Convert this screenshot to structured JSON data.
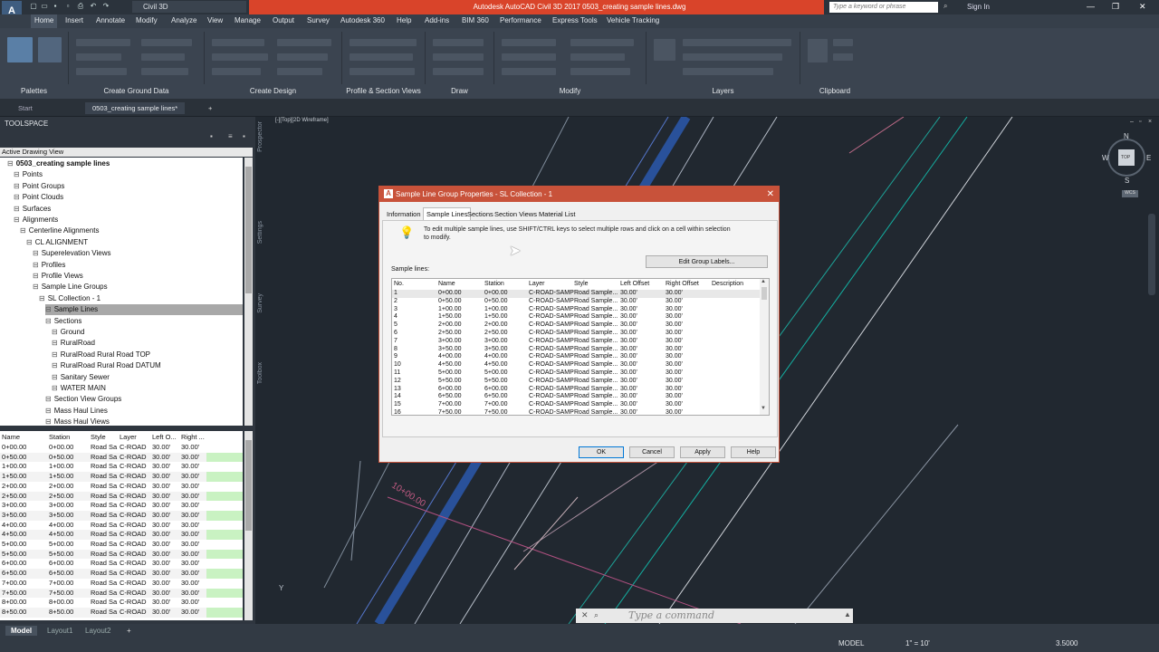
{
  "title_bar": {
    "app_title": "Autodesk AutoCAD Civil 3D 2017   0503_creating sample lines.dwg",
    "workspace": "Civil 3D",
    "search_placeholder": "Type a keyword or phrase",
    "sign_in": "Sign In"
  },
  "menu_tabs": [
    "Home",
    "Insert",
    "Annotate",
    "Modify",
    "Analyze",
    "View",
    "Manage",
    "Output",
    "Survey",
    "Autodesk 360",
    "Help",
    "Add-ins",
    "BIM 360",
    "Performance",
    "Express Tools",
    "Vehicle Tracking"
  ],
  "ribbon_panels": [
    "Palettes",
    "Create Ground Data",
    "Create Design",
    "Profile & Section Views",
    "Draw",
    "Modify",
    "Layers",
    "Clipboard"
  ],
  "doc_tabs": [
    "Start",
    "0503_creating sample lines*"
  ],
  "toolspace": {
    "title": "TOOLSPACE",
    "view_label": "Active Drawing View",
    "tree": [
      {
        "label": "0503_creating sample lines",
        "level": 0,
        "bold": true
      },
      {
        "label": "Points",
        "level": 1
      },
      {
        "label": "Point Groups",
        "level": 1
      },
      {
        "label": "Point Clouds",
        "level": 1
      },
      {
        "label": "Surfaces",
        "level": 1
      },
      {
        "label": "Alignments",
        "level": 1
      },
      {
        "label": "Centerline Alignments",
        "level": 2
      },
      {
        "label": "CL ALIGNMENT",
        "level": 3
      },
      {
        "label": "Superelevation Views",
        "level": 4
      },
      {
        "label": "Profiles",
        "level": 4
      },
      {
        "label": "Profile Views",
        "level": 4
      },
      {
        "label": "Sample Line Groups",
        "level": 4
      },
      {
        "label": "SL Collection - 1",
        "level": 5
      },
      {
        "label": "Sample Lines",
        "level": 6,
        "selected": true
      },
      {
        "label": "Sections",
        "level": 6
      },
      {
        "label": "Ground",
        "level": 7
      },
      {
        "label": "RuralRoad",
        "level": 7
      },
      {
        "label": "RuralRoad Rural Road TOP",
        "level": 7
      },
      {
        "label": "RuralRoad Rural Road DATUM",
        "level": 7
      },
      {
        "label": "Sanitary Sewer",
        "level": 7
      },
      {
        "label": "WATER MAIN",
        "level": 7
      },
      {
        "label": "Section View Groups",
        "level": 6
      },
      {
        "label": "Mass Haul Lines",
        "level": 6
      },
      {
        "label": "Mass Haul Views",
        "level": 6
      }
    ],
    "list_headers": [
      "Name",
      "Station",
      "Style",
      "Layer",
      "Left O...",
      "Right ..."
    ],
    "list_rows": [
      [
        "0+00.00",
        "0+00.00"
      ],
      [
        "0+50.00",
        "0+50.00"
      ],
      [
        "1+00.00",
        "1+00.00"
      ],
      [
        "1+50.00",
        "1+50.00"
      ],
      [
        "2+00.00",
        "2+00.00"
      ],
      [
        "2+50.00",
        "2+50.00"
      ],
      [
        "3+00.00",
        "3+00.00"
      ],
      [
        "3+50.00",
        "3+50.00"
      ],
      [
        "4+00.00",
        "4+00.00"
      ],
      [
        "4+50.00",
        "4+50.00"
      ],
      [
        "5+00.00",
        "5+00.00"
      ],
      [
        "5+50.00",
        "5+50.00"
      ],
      [
        "6+00.00",
        "6+00.00"
      ],
      [
        "6+50.00",
        "6+50.00"
      ],
      [
        "7+00.00",
        "7+00.00"
      ],
      [
        "7+50.00",
        "7+50.00"
      ],
      [
        "8+00.00",
        "8+00.00"
      ],
      [
        "8+50.00",
        "8+50.00"
      ]
    ],
    "list_style": "Road Sa",
    "list_layer": "C-ROAD",
    "list_offset": "30.00'",
    "side_tabs": [
      "Prospector",
      "Settings",
      "Survey",
      "Toolbox"
    ]
  },
  "viewport_label": "[-][Top][2D Wireframe]",
  "compass": {
    "n": "N",
    "s": "S",
    "e": "E",
    "w": "W",
    "top": "TOP",
    "wcs": "WCS"
  },
  "drawing_station_label": "10+00.00",
  "dialog": {
    "title": "Sample Line Group Properties - SL Collection - 1",
    "tabs": [
      "Information",
      "Sample Lines",
      "Sections",
      "Section Views",
      "Material List"
    ],
    "hint": "To edit multiple sample lines, use SHIFT/CTRL keys to select multiple rows and click on a cell within selection to modify.",
    "edit_labels_button": "Edit Group Labels...",
    "table_title": "Sample lines:",
    "headers": [
      "No.",
      "Name",
      "Station",
      "Layer",
      "Style",
      "Left Offset",
      "Right Offset",
      "Description"
    ],
    "rows": [
      [
        "1",
        "0+00.00",
        "0+00.00"
      ],
      [
        "2",
        "0+50.00",
        "0+50.00"
      ],
      [
        "3",
        "1+00.00",
        "1+00.00"
      ],
      [
        "4",
        "1+50.00",
        "1+50.00"
      ],
      [
        "5",
        "2+00.00",
        "2+00.00"
      ],
      [
        "6",
        "2+50.00",
        "2+50.00"
      ],
      [
        "7",
        "3+00.00",
        "3+00.00"
      ],
      [
        "8",
        "3+50.00",
        "3+50.00"
      ],
      [
        "9",
        "4+00.00",
        "4+00.00"
      ],
      [
        "10",
        "4+50.00",
        "4+50.00"
      ],
      [
        "11",
        "5+00.00",
        "5+00.00"
      ],
      [
        "12",
        "5+50.00",
        "5+50.00"
      ],
      [
        "13",
        "6+00.00",
        "6+00.00"
      ],
      [
        "14",
        "6+50.00",
        "6+50.00"
      ],
      [
        "15",
        "7+00.00",
        "7+00.00"
      ],
      [
        "16",
        "7+50.00",
        "7+50.00"
      ]
    ],
    "row_layer": "C-ROAD-SAMP",
    "row_style": "Road Sample...",
    "row_offset": "30.00'",
    "buttons": {
      "ok": "OK",
      "cancel": "Cancel",
      "apply": "Apply",
      "help": "Help"
    }
  },
  "command_line": {
    "placeholder": "Type a command"
  },
  "layout_tabs": [
    "Model",
    "Layout1",
    "Layout2"
  ],
  "status_bar": {
    "mode": "MODEL",
    "scale": "1\" = 10'",
    "precision": "3.5000"
  }
}
